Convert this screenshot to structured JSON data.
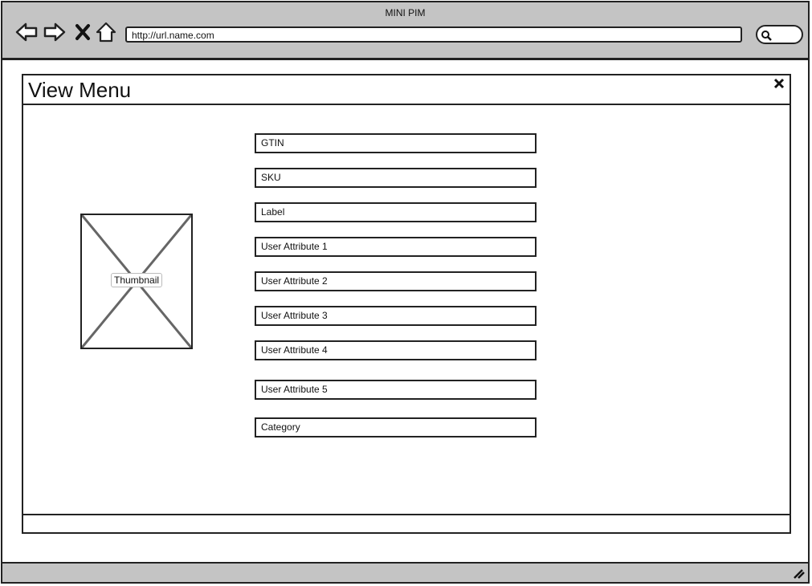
{
  "window": {
    "title": "MINI PIM"
  },
  "toolbar": {
    "back_icon": "back-arrow-icon",
    "forward_icon": "forward-arrow-icon",
    "stop_icon": "close-x-icon",
    "home_icon": "home-icon",
    "url": "http://url.name.com",
    "search_icon": "search-icon"
  },
  "dialog": {
    "title": "View Menu",
    "close_icon": "close-icon",
    "thumbnail_label": "Thumbnail",
    "fields": [
      "GTIN",
      "SKU",
      "Label",
      "User Attribute 1",
      "User Attribute 2",
      "User Attribute 3",
      "User Attribute 4",
      "User Attribute 5",
      "Category"
    ]
  },
  "colors": {
    "chrome": "#c4c4c4",
    "border": "#222222"
  }
}
